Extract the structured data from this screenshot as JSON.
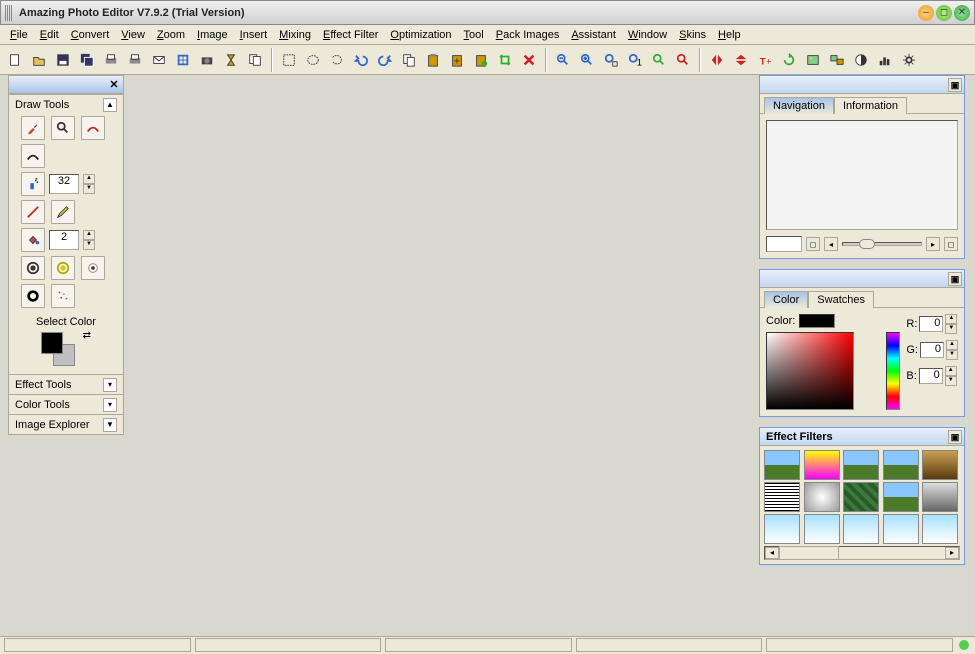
{
  "window": {
    "title": "Amazing Photo Editor V7.9.2 (Trial Version)"
  },
  "menu": [
    "File",
    "Edit",
    "Convert",
    "View",
    "Zoom",
    "Image",
    "Insert",
    "Mixing",
    "Effect Filter",
    "Optimization",
    "Tool",
    "Pack Images",
    "Assistant",
    "Window",
    "Skins",
    "Help"
  ],
  "toolbar_icons": [
    "new-file",
    "open",
    "save",
    "save-all",
    "print-all",
    "print",
    "email",
    "acquire",
    "camera",
    "hourglass",
    "batch",
    "sep",
    "select-rect",
    "select-ellipse",
    "select-lasso",
    "undo",
    "redo",
    "copy",
    "paste",
    "paste-into",
    "paste-new",
    "crop",
    "delete",
    "sep",
    "zoom-out",
    "zoom-in",
    "zoom-fit",
    "zoom-actual",
    "zoom-sel",
    "zoom-page",
    "sep",
    "flip-h",
    "flip-v",
    "text",
    "refresh",
    "image-info",
    "image-gallery",
    "contrast",
    "levels",
    "settings"
  ],
  "left_panel": {
    "sections": {
      "draw_tools": "Draw Tools",
      "select_color": "Select Color",
      "effect_tools": "Effect Tools",
      "color_tools": "Color Tools",
      "image_explorer": "Image Explorer"
    },
    "spray_size": "32",
    "fill_tol": "2"
  },
  "nav_panel": {
    "tabs": [
      "Navigation",
      "Information"
    ],
    "active": 0
  },
  "color_panel": {
    "tabs": [
      "Color",
      "Swatches"
    ],
    "active": 0,
    "label": "Color:",
    "r_label": "R:",
    "g_label": "G:",
    "b_label": "B:",
    "r": "0",
    "g": "0",
    "b": "0"
  },
  "fx_panel": {
    "title": "Effect Filters"
  }
}
